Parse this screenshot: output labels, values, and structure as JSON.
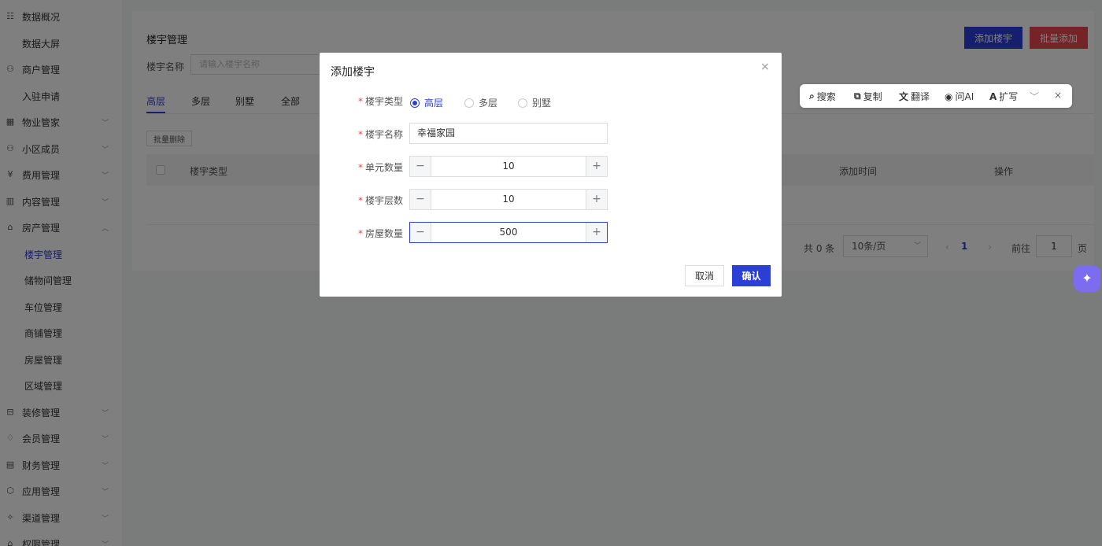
{
  "sidebar": {
    "items": [
      {
        "label": "数据概况",
        "icon": "calendar-icon",
        "chevron": ""
      },
      {
        "label": "数据大屏",
        "icon": "",
        "chevron": ""
      },
      {
        "label": "商户管理",
        "icon": "users-icon",
        "chevron": ""
      },
      {
        "label": "入驻申请",
        "icon": "",
        "chevron": ""
      },
      {
        "label": "物业管家",
        "icon": "building-icon",
        "chevron": "﹀"
      },
      {
        "label": "小区成员",
        "icon": "users-icon",
        "chevron": "﹀"
      },
      {
        "label": "费用管理",
        "icon": "yen-icon",
        "chevron": "﹀"
      },
      {
        "label": "内容管理",
        "icon": "book-icon",
        "chevron": "﹀"
      },
      {
        "label": "房产管理",
        "icon": "house-icon",
        "chevron": "︿"
      },
      {
        "label": "楼宇管理",
        "icon": "",
        "chevron": ""
      },
      {
        "label": "储物间管理",
        "icon": "",
        "chevron": ""
      },
      {
        "label": "车位管理",
        "icon": "",
        "chevron": ""
      },
      {
        "label": "商铺管理",
        "icon": "",
        "chevron": ""
      },
      {
        "label": "房屋管理",
        "icon": "",
        "chevron": ""
      },
      {
        "label": "区域管理",
        "icon": "",
        "chevron": ""
      },
      {
        "label": "装修管理",
        "icon": "sofa-icon",
        "chevron": "﹀"
      },
      {
        "label": "会员管理",
        "icon": "diamond-icon",
        "chevron": "﹀"
      },
      {
        "label": "财务管理",
        "icon": "wallet-icon",
        "chevron": "﹀"
      },
      {
        "label": "应用管理",
        "icon": "cube-icon",
        "chevron": "﹀"
      },
      {
        "label": "渠道管理",
        "icon": "share-icon",
        "chevron": "﹀"
      },
      {
        "label": "权限管理",
        "icon": "lock-icon",
        "chevron": "﹀"
      }
    ]
  },
  "page": {
    "title": "楼宇管理",
    "filter_label": "楼宇名称",
    "filter_placeholder": "请输入楼宇名称",
    "add_button": "添加楼宇",
    "batch_add_button": "批量添加",
    "tabs": [
      "高层",
      "多层",
      "别墅",
      "全部"
    ],
    "batch_delete": "批量删除",
    "columns": [
      "楼宇类型",
      "添加时间",
      "操作"
    ],
    "pagination": {
      "total": "共 0 条",
      "page_size": "10条/页",
      "prev": "‹",
      "current": "1",
      "next": "›",
      "goto_label": "前往",
      "goto_value": "1",
      "page_suffix": "页"
    }
  },
  "dialog": {
    "title": "添加楼宇",
    "close": "×",
    "type_label": "楼宇类型",
    "type_options": [
      "高层",
      "多层",
      "别墅"
    ],
    "type_selected": "高层",
    "name_label": "楼宇名称",
    "name_value": "幸福家园",
    "units_label": "单元数量",
    "units_value": "10",
    "floors_label": "楼宇层数",
    "floors_value": "10",
    "houses_label": "房屋数量",
    "houses_value": "500",
    "minus": "−",
    "plus": "+",
    "cancel": "取消",
    "confirm": "确认"
  },
  "selection_toolbar": {
    "search": "搜索",
    "copy": "复制",
    "translate": "翻译",
    "ask_ai": "问AI",
    "expand": "扩写",
    "more": "﹀",
    "close": "×"
  },
  "colors": {
    "primary": "#2b3ed6",
    "danger": "#e8474d",
    "assistant": "#7b6cf0"
  }
}
